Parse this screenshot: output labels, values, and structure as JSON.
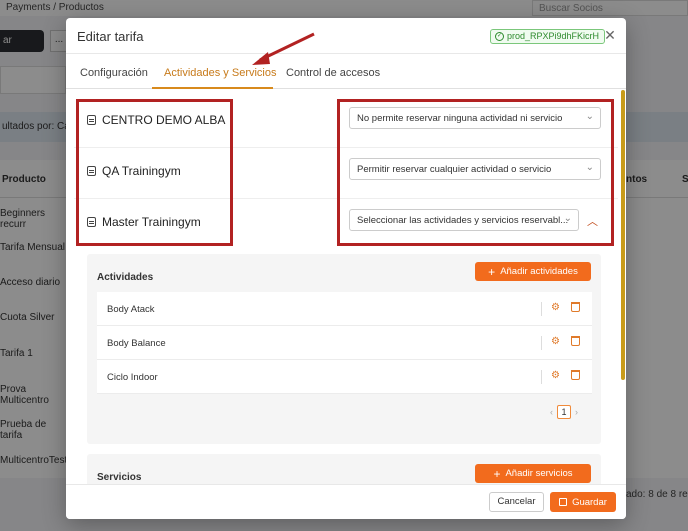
{
  "background": {
    "breadcrumb": "Payments  /  Productos",
    "search_placeholder": "Buscar Socios",
    "primary_button": "ar",
    "more_button": "...",
    "results_text": "ultados por: Ca",
    "table_header_product": "Producto",
    "table_header_right": "ntos",
    "table_header_far": "S",
    "rows": [
      "Beginners recurr",
      "Tarifa Mensual",
      "Acceso diario",
      "Cuota Silver",
      "Tarifa 1",
      "Prova Multicentro",
      "Prueba de tarifa",
      "MulticentroTests"
    ],
    "pagination": "ado: 8 de 8 res"
  },
  "modal": {
    "title": "Editar tarifa",
    "product_id": "prod_RPXPi9dhFKicrH",
    "tabs": [
      "Configuración",
      "Actividades y Servicios",
      "Control de accesos"
    ],
    "active_tab": 1,
    "centers": [
      {
        "name": "CENTRO DEMO ALBA",
        "option": "No permite reservar ninguna actividad ni servicio"
      },
      {
        "name": "QA Trainingym",
        "option": "Permitir reservar cualquier actividad o servicio"
      },
      {
        "name": "Master Trainingym",
        "option": "Seleccionar las actividades y servicios reservabl..."
      }
    ],
    "activities": {
      "title": "Actividades",
      "add_label": "Añadir actividades",
      "items": [
        "Body Atack",
        "Body Balance",
        "Ciclo Indoor"
      ],
      "page": "1"
    },
    "services": {
      "title": "Servicios",
      "add_label": "Añadir servicios"
    },
    "cancel_label": "Cancelar",
    "save_label": "Guardar"
  },
  "colors": {
    "accent": "#f26b1d",
    "annotation": "#b22222",
    "badge_green": "#2e8b2e"
  }
}
